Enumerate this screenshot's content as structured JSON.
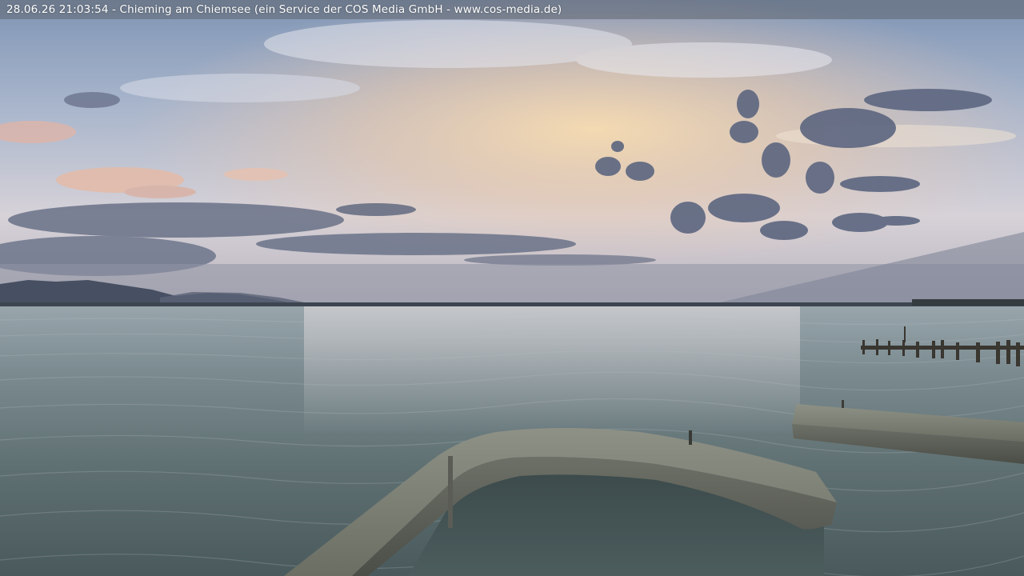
{
  "overlay": {
    "caption": "28.06.26 21:03:54 - Chieming am Chiemsee (ein Service der COS Media GmbH - www.cos-media.de)"
  },
  "scene": {
    "subject": "webcam-lake-view-at-dusk",
    "colors": {
      "sky_top": "#7d93b3",
      "sky_mid": "#c8ccd8",
      "sunset_glow": "#f3d4a8",
      "cloud_dark": "#5a6478",
      "mountains": "#3e4656",
      "water_far": "#8a9aa2",
      "water_near": "#4a5b5e",
      "breakwater": "#7f8276"
    }
  }
}
